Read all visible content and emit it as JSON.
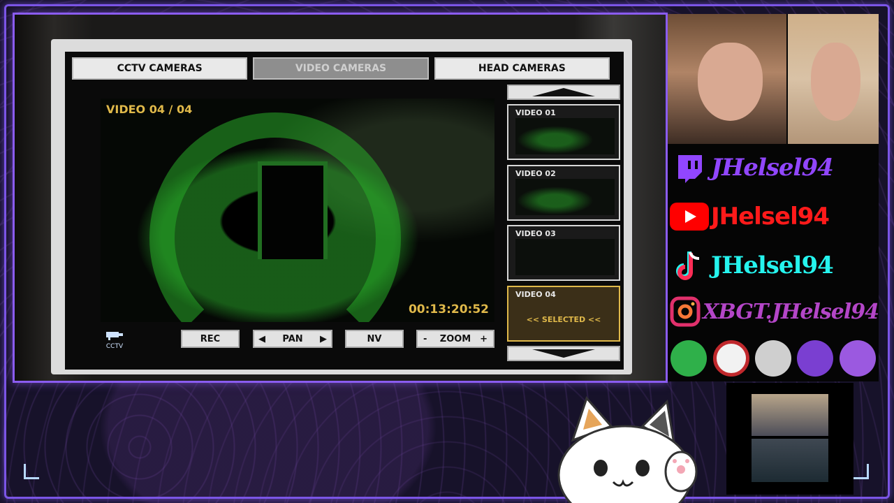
{
  "tabs": [
    {
      "label": "CCTV CAMERAS",
      "active": false
    },
    {
      "label": "VIDEO CAMERAS",
      "active": true
    },
    {
      "label": "HEAD CAMERAS",
      "active": false
    }
  ],
  "feed": {
    "label": "VIDEO 04 / 04",
    "timestamp": "00:13:20:52"
  },
  "controls": {
    "rec": "REC",
    "pan": "PAN",
    "nv": "NV",
    "zoom": "ZOOM",
    "zoom_minus": "-",
    "zoom_plus": "+",
    "pan_left": "◀",
    "pan_right": "▶",
    "logo_text": "CCTV"
  },
  "thumbnails": [
    {
      "label": "VIDEO 01"
    },
    {
      "label": "VIDEO 02"
    },
    {
      "label": "VIDEO 03"
    },
    {
      "label": "VIDEO 04",
      "selected_text": "<< SELECTED <<"
    }
  ],
  "social": {
    "twitch": "JHelsel94",
    "youtube": "JHelsel94",
    "tiktok": "JHelsel94",
    "instagram": "XBGT.JHelsel94"
  },
  "colors": {
    "accent_purple": "#7b55e6",
    "feed_text": "#e0b94a",
    "twitch": "#9146ff",
    "youtube": "#ff0000",
    "tiktok": "#25f4ee",
    "instagram": "#c13584"
  }
}
